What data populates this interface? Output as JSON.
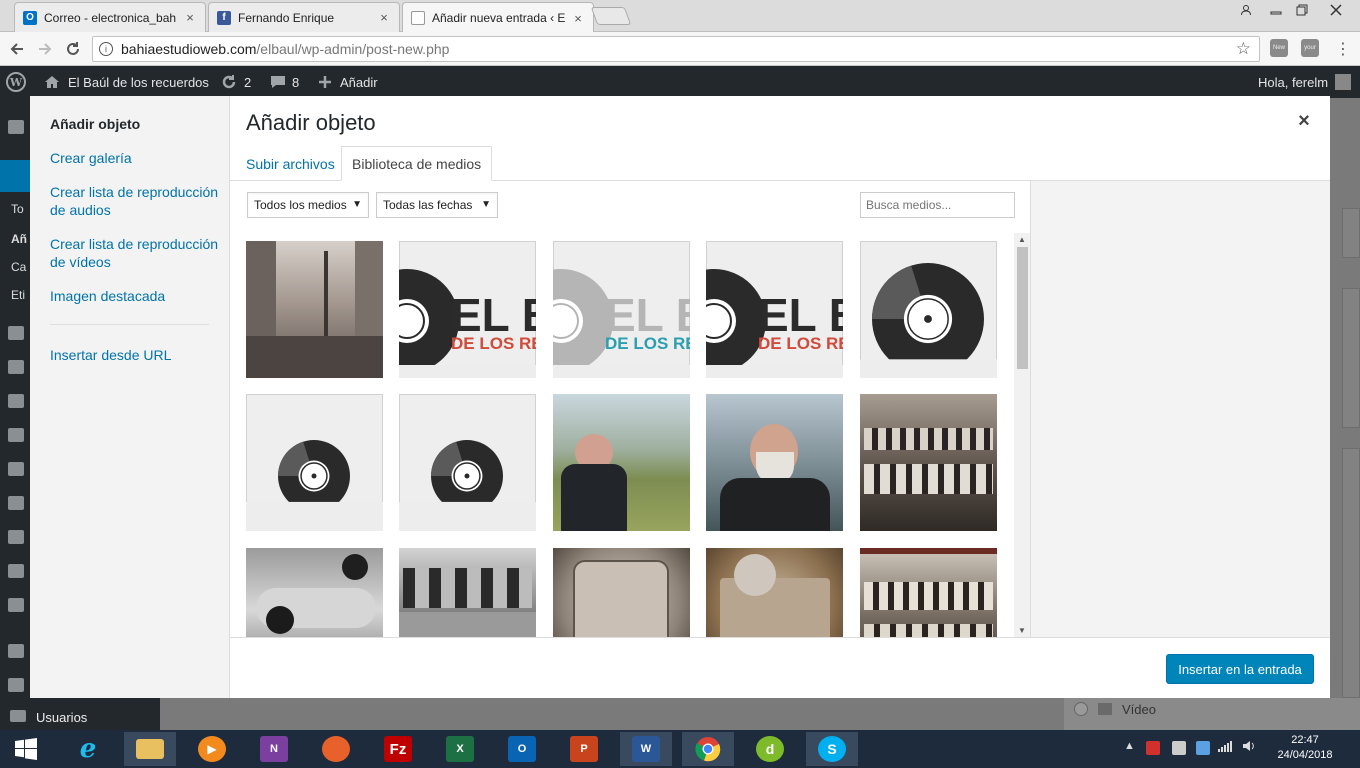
{
  "browser": {
    "tabs": [
      {
        "title": "Correo - electronica_bah",
        "favicon_color": "#0072c6",
        "favicon_glyph": "O"
      },
      {
        "title": "Fernando Enrique",
        "favicon_color": "#3b5998",
        "favicon_glyph": "f"
      },
      {
        "title": "Añadir nueva entrada ‹ E",
        "favicon_color": "#ffffff",
        "favicon_glyph": ""
      }
    ],
    "url_host": "bahiaestudioweb.com",
    "url_path": "/elbaul/wp-admin/post-new.php",
    "extensions": [
      "New",
      "your"
    ]
  },
  "adminbar": {
    "site_name": "El Baúl de los recuerdos",
    "updates": "2",
    "comments": "8",
    "new_label": "Añadir",
    "greeting": "Hola, ferelm"
  },
  "wp_side_labels": [
    "To",
    "Añ",
    "Ca",
    "Eti"
  ],
  "wp_bottom_item": "Usuarios",
  "wp_video_label": "Vídeo",
  "modal": {
    "menu": {
      "active": "Añadir objeto",
      "items": [
        "Crear galería",
        "Crear lista de reproducción de audios",
        "Crear lista de reproducción de vídeos",
        "Imagen destacada"
      ],
      "url_item": "Insertar desde URL"
    },
    "title": "Añadir objeto",
    "close_glyph": "×",
    "tabs": {
      "upload": "Subir archivos",
      "library": "Biblioteca de medios"
    },
    "filters": {
      "media_type": "Todos los medios",
      "dates": "Todas las fechas"
    },
    "search_placeholder": "Busca medios...",
    "logo_text": {
      "line1": "EL BA",
      "line2": "DE LOS REC"
    },
    "attachments": [
      {
        "kind": "photo-street"
      },
      {
        "kind": "logo-partial"
      },
      {
        "kind": "logo-partial-teal"
      },
      {
        "kind": "logo-partial"
      },
      {
        "kind": "vinyl-large"
      },
      {
        "kind": "vinyl-small"
      },
      {
        "kind": "vinyl-small"
      },
      {
        "kind": "photo-man-park"
      },
      {
        "kind": "photo-man-window"
      },
      {
        "kind": "photo-team"
      },
      {
        "kind": "photo-racecar"
      },
      {
        "kind": "photo-group"
      },
      {
        "kind": "photo-plaque"
      },
      {
        "kind": "photo-plaque2"
      },
      {
        "kind": "photo-team2"
      }
    ],
    "insert_button": "Insertar en la entrada"
  },
  "taskbar": {
    "apps": [
      "start",
      "ie",
      "explorer",
      "media",
      "onenote",
      "firefox",
      "filezilla",
      "excel",
      "outlook",
      "powerpoint",
      "word",
      "chrome",
      "dreamweaver",
      "skype"
    ],
    "clock_time": "22:47",
    "clock_date": "24/04/2018"
  },
  "colors": {
    "accent": "#0073aa",
    "button": "#0085ba",
    "adminbar": "#23282d"
  }
}
